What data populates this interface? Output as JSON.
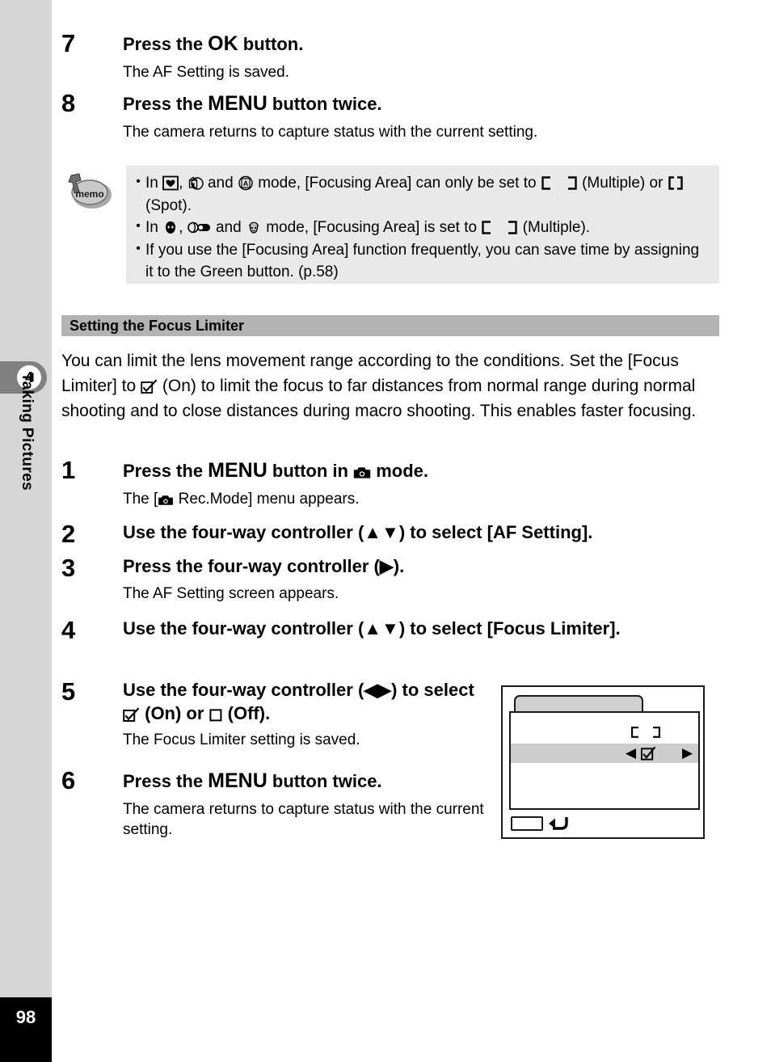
{
  "sidebar": {
    "chapter_number": "4",
    "chapter_title": "Taking Pictures",
    "page_number": "98"
  },
  "steps_top": [
    {
      "number": "7",
      "title_pre": "Press the ",
      "title_kbd": "OK",
      "title_post": " button.",
      "desc": "The AF Setting is saved."
    },
    {
      "number": "8",
      "title_pre": "Press the ",
      "title_kbd": "MENU",
      "title_post": " button twice.",
      "desc": "The camera returns to capture status with the current setting."
    }
  ],
  "memo": {
    "icon_label": "memo",
    "bullet_char": "•",
    "bullets": [
      {
        "part1": "In ",
        "icon1": "pet-heart-mode-icon",
        "part2": ", ",
        "icon2": "museum-mode-icon",
        "part3": " and ",
        "icon3": "text-mode-icon",
        "part4": " mode, [Focusing Area] can only be set to ",
        "icon4": "focus-multiple-icon",
        "part5": " (Multiple) or ",
        "icon5": "focus-spot-icon",
        "part6": " (Spot)."
      },
      {
        "part1": "In ",
        "icon1": "portrait-mode-icon",
        "part2": ", ",
        "icon2": "movie-mode-icon",
        "part3": " and ",
        "icon3": "kids-mode-icon",
        "part4": " mode, [Focusing Area] is set to ",
        "icon4": "focus-multiple-icon",
        "part5": " (Multiple).",
        "icon5": "",
        "part6": ""
      },
      {
        "text": "If you use the [Focusing Area] function frequently, you can save time by assigning it to the Green button. (p.58)"
      }
    ]
  },
  "section": {
    "header": "Setting the Focus Limiter",
    "intro_part1": "You can limit the lens movement range according to the conditions. Set the [Focus Limiter] to ",
    "intro_icon": "checkbox-on-icon",
    "intro_part2": " (On) to limit the focus to far distances from normal range during normal shooting and to close distances during macro shooting. This enables faster focusing."
  },
  "steps_main": [
    {
      "number": "1",
      "title_pre": "Press the ",
      "title_kbd": "MENU",
      "title_mid": " button in ",
      "title_icon": "camera-mode-icon",
      "title_post": " mode.",
      "desc_pre": "The [",
      "desc_icon": "camera-mode-icon",
      "desc_post": " Rec.Mode] menu appears."
    },
    {
      "number": "2",
      "title": "Use the four-way controller (▲▼) to select [AF Setting].",
      "desc": ""
    },
    {
      "number": "3",
      "title": "Press the four-way controller (▶).",
      "desc": "The AF Setting screen appears."
    },
    {
      "number": "4",
      "title": "Use the four-way controller (▲▼) to select [Focus Limiter].",
      "desc": ""
    },
    {
      "number": "5",
      "title_pre": "Use the four-way controller (◀▶) to select ",
      "title_icon_on": "checkbox-on-icon",
      "title_mid": " (On) or ",
      "title_icon_off": "checkbox-off-icon",
      "title_post": " (Off).",
      "desc": "The Focus Limiter setting is saved."
    },
    {
      "number": "6",
      "title_pre": "Press the ",
      "title_kbd": "MENU",
      "title_post": " button twice.",
      "desc": "The camera returns to capture status with the current setting."
    }
  ],
  "lcd_figure": {
    "tab_name": "menu-tab",
    "row_focus_area_icon": "focus-multiple-icon",
    "row_limiter_left_arrow": "◀",
    "row_limiter_icon": "checkbox-on-icon",
    "row_limiter_right_arrow": "▶",
    "menu_button_label": "",
    "back_arrow_icon": "back-arrow-icon"
  },
  "colors": {
    "sidebar_bg": "#d6d6d6",
    "chapter_tab": "#808080",
    "section_header_bg": "#b3b3b3",
    "memo_bg": "#e9e9e9",
    "lcd_highlight": "#cdcdcd",
    "page_number_bg": "#000000"
  }
}
